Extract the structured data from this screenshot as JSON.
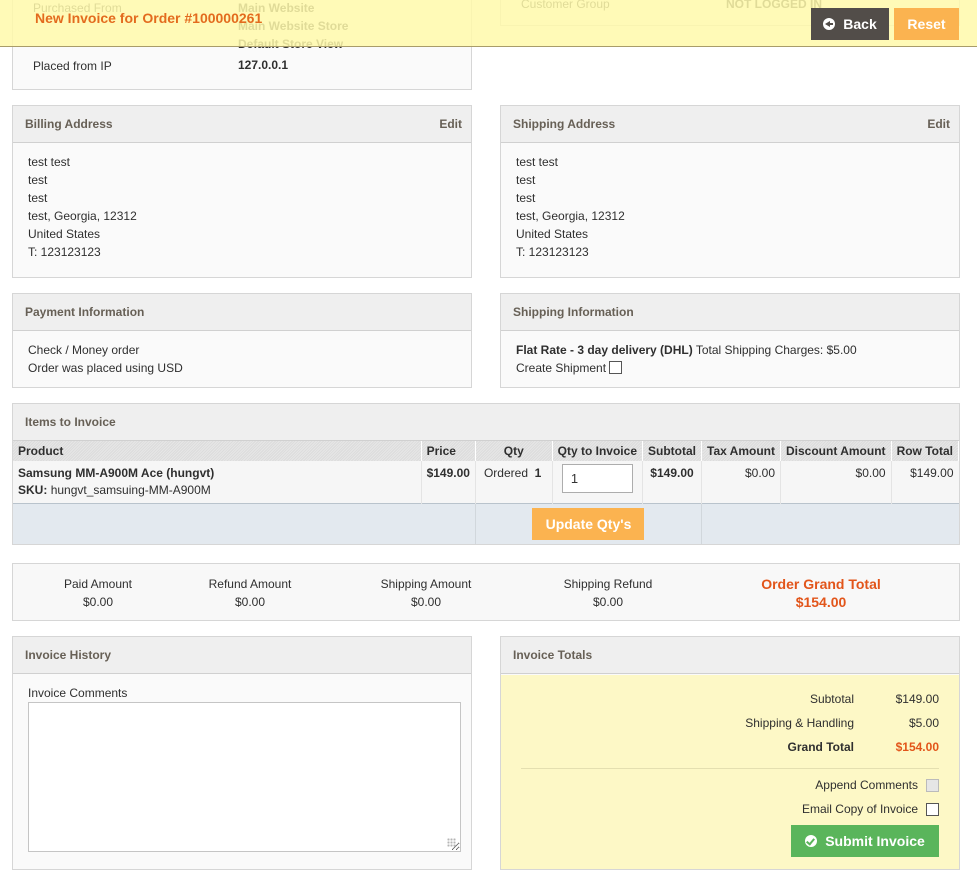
{
  "header": {
    "title": "New Invoice for Order #100000261",
    "back_label": "Back",
    "reset_label": "Reset"
  },
  "order_info": {
    "purchased_from_label": "Purchased From",
    "purchased_from_lines": [
      "Main Website",
      "Main Website Store",
      "Default Store View"
    ],
    "placed_from_ip_label": "Placed from IP",
    "placed_from_ip_value": "127.0.0.1",
    "customer_group_label": "Customer Group",
    "customer_group_value": "NOT LOGGED IN"
  },
  "billing_address": {
    "title": "Billing Address",
    "edit_label": "Edit",
    "lines": [
      "test test",
      "test",
      "test",
      "test, Georgia, 12312",
      "United States",
      "T: 123123123"
    ]
  },
  "shipping_address": {
    "title": "Shipping Address",
    "edit_label": "Edit",
    "lines": [
      "test test",
      "test",
      "test",
      "test, Georgia, 12312",
      "United States",
      "T: 123123123"
    ]
  },
  "payment": {
    "title": "Payment Information",
    "method": "Check / Money order",
    "currency_note": "Order was placed using USD"
  },
  "shipping_info": {
    "title": "Shipping Information",
    "method": "Flat Rate - 3 day delivery (DHL)",
    "charges_label": "Total Shipping Charges: $5.00",
    "create_shipment_label": "Create Shipment",
    "create_shipment_checked": false
  },
  "items": {
    "title": "Items to Invoice",
    "columns": [
      "Product",
      "Price",
      "Qty",
      "Qty to Invoice",
      "Subtotal",
      "Tax Amount",
      "Discount Amount",
      "Row Total"
    ],
    "rows": [
      {
        "product_name": "Samsung MM-A900M Ace (hungvt)",
        "sku_label": "SKU:",
        "sku": "hungvt_samsuing-MM-A900M",
        "price": "$149.00",
        "qty_label": "Ordered",
        "qty_value": "1",
        "qty_to_invoice": "1",
        "subtotal": "$149.00",
        "tax": "$0.00",
        "discount": "$0.00",
        "row_total": "$149.00"
      }
    ],
    "update_label": "Update Qty's"
  },
  "summary": {
    "paid_label": "Paid Amount",
    "paid_value": "$0.00",
    "refund_label": "Refund Amount",
    "refund_value": "$0.00",
    "shipping_label": "Shipping Amount",
    "shipping_value": "$0.00",
    "shipping_refund_label": "Shipping Refund",
    "shipping_refund_value": "$0.00",
    "grand_total_label": "Order Grand Total",
    "grand_total_value": "$154.00"
  },
  "history": {
    "title": "Invoice History",
    "comments_label": "Invoice Comments",
    "comments_value": ""
  },
  "totals": {
    "title": "Invoice Totals",
    "subtotal_label": "Subtotal",
    "subtotal_value": "$149.00",
    "shipping_label": "Shipping & Handling",
    "shipping_value": "$5.00",
    "grand_label": "Grand Total",
    "grand_value": "$154.00",
    "append_label": "Append Comments",
    "append_checked": false,
    "email_label": "Email Copy of Invoice",
    "email_checked": false,
    "submit_label": "Submit Invoice"
  },
  "colors": {
    "accent_orange": "#e2551a",
    "button_orange": "#fbb350",
    "button_dark": "#524d49",
    "button_green": "#5ab55b",
    "sticky_bg": "#fff9aa"
  }
}
